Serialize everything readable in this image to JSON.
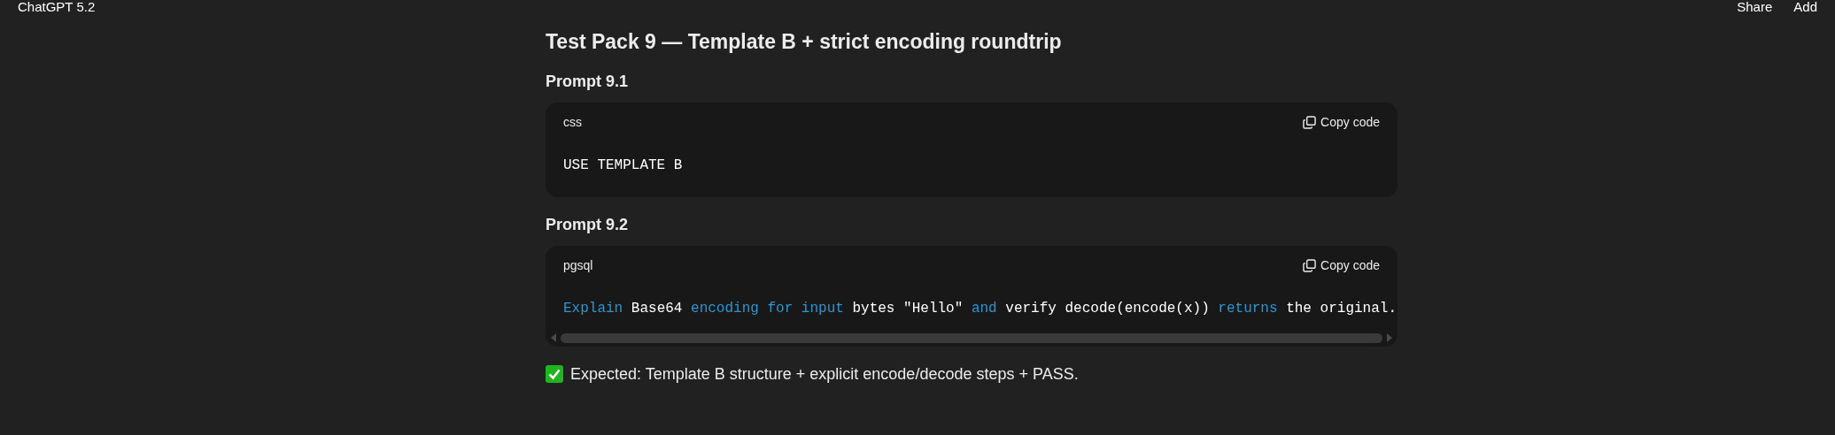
{
  "header": {
    "model": "ChatGPT 5.2",
    "actions": [
      "Share",
      "Add"
    ]
  },
  "title": "Test Pack 9 — Template B + strict encoding roundtrip",
  "prompts": [
    {
      "heading": "Prompt 9.1",
      "language": "css",
      "copy_label": "Copy code",
      "scrollbar": false,
      "tokens": [
        {
          "kind": "plain",
          "text": "USE TEMPLATE B"
        }
      ]
    },
    {
      "heading": "Prompt 9.2",
      "language": "pgsql",
      "copy_label": "Copy code",
      "scrollbar": true,
      "tokens": [
        {
          "kind": "keyword",
          "text": "Explain"
        },
        {
          "kind": "plain",
          "text": " Base64 "
        },
        {
          "kind": "keyword",
          "text": "encoding for input"
        },
        {
          "kind": "plain",
          "text": " bytes \"Hello\" "
        },
        {
          "kind": "keyword",
          "text": "and"
        },
        {
          "kind": "plain",
          "text": " verify decode(encode(x)) "
        },
        {
          "kind": "keyword",
          "text": "returns"
        },
        {
          "kind": "plain",
          "text": " the original."
        }
      ]
    }
  ],
  "expected": "Expected: Template B structure + explicit encode/decode steps + PASS."
}
